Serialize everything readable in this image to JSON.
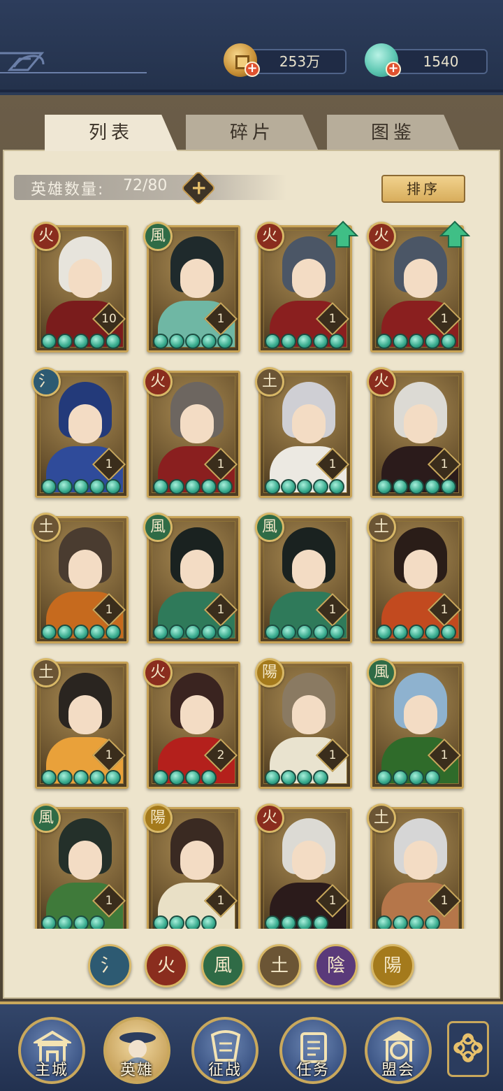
{
  "currency": {
    "copper": {
      "value": "253万",
      "icon": "copper-coin-icon"
    },
    "jade": {
      "value": "1540",
      "icon": "jade-icon"
    }
  },
  "tabs": [
    {
      "label": "列表",
      "active": true
    },
    {
      "label": "碎片",
      "active": false
    },
    {
      "label": "图鉴",
      "active": false
    }
  ],
  "hero_count": {
    "label": "英雄数量:",
    "value": "72/80"
  },
  "sort_button": "排序",
  "element_colors": {
    "水": "#2d5a72",
    "火": "#8a2d1e",
    "风": "#2f6b46",
    "土": "#6b5535",
    "阴": "#5a3a7a",
    "阳": "#a47a1c"
  },
  "element_glyphs": {
    "水": "氵",
    "火": "火",
    "风": "風",
    "土": "土",
    "阴": "陰",
    "阳": "陽"
  },
  "heroes": [
    {
      "element": "火",
      "level": "10",
      "stars": 5,
      "upgrade": false,
      "hair": "#e7e4dc",
      "outfit": "#7a1c1c"
    },
    {
      "element": "风",
      "level": "1",
      "stars": 5,
      "upgrade": false,
      "hair": "#1f2a2c",
      "outfit": "#6fb7a4"
    },
    {
      "element": "火",
      "level": "1",
      "stars": 5,
      "upgrade": true,
      "hair": "#4b5666",
      "outfit": "#8a1f1f"
    },
    {
      "element": "火",
      "level": "1",
      "stars": 5,
      "upgrade": true,
      "hair": "#4b5666",
      "outfit": "#8a1f1f"
    },
    {
      "element": "水",
      "level": "1",
      "stars": 5,
      "upgrade": false,
      "hair": "#233a7a",
      "outfit": "#2f4b9a"
    },
    {
      "element": "火",
      "level": "1",
      "stars": 5,
      "upgrade": false,
      "hair": "#6d6660",
      "outfit": "#8a1f1f"
    },
    {
      "element": "土",
      "level": "1",
      "stars": 5,
      "upgrade": false,
      "hair": "#cfcfd4",
      "outfit": "#ece9e2"
    },
    {
      "element": "火",
      "level": "1",
      "stars": 5,
      "upgrade": false,
      "hair": "#dcdad4",
      "outfit": "#2b1b1b"
    },
    {
      "element": "土",
      "level": "1",
      "stars": 5,
      "upgrade": false,
      "hair": "#4a3c30",
      "outfit": "#c66a1e"
    },
    {
      "element": "风",
      "level": "1",
      "stars": 5,
      "upgrade": false,
      "hair": "#1a2220",
      "outfit": "#2f7a5a"
    },
    {
      "element": "风",
      "level": "1",
      "stars": 5,
      "upgrade": false,
      "hair": "#1a2220",
      "outfit": "#2f7a5a"
    },
    {
      "element": "土",
      "level": "1",
      "stars": 5,
      "upgrade": false,
      "hair": "#2a1d18",
      "outfit": "#c24a1f"
    },
    {
      "element": "土",
      "level": "1",
      "stars": 5,
      "upgrade": false,
      "hair": "#2a2520",
      "outfit": "#e9a13a"
    },
    {
      "element": "火",
      "level": "2",
      "stars": 4,
      "upgrade": false,
      "hair": "#3a2420",
      "outfit": "#b4201c"
    },
    {
      "element": "阳",
      "level": "1",
      "stars": 4,
      "upgrade": false,
      "hair": "#8a7a62",
      "outfit": "#e9e3cf"
    },
    {
      "element": "风",
      "level": "1",
      "stars": 4,
      "upgrade": false,
      "hair": "#8eb2cf",
      "outfit": "#2f6b2a"
    },
    {
      "element": "风",
      "level": "1",
      "stars": 4,
      "upgrade": false,
      "hair": "#24302a",
      "outfit": "#3f7a3a"
    },
    {
      "element": "阳",
      "level": "1",
      "stars": 4,
      "upgrade": false,
      "hair": "#3a2a22",
      "outfit": "#e9e0c6"
    },
    {
      "element": "火",
      "level": "1",
      "stars": 4,
      "upgrade": false,
      "hair": "#dcdad4",
      "outfit": "#2b1b1b"
    },
    {
      "element": "土",
      "level": "1",
      "stars": 4,
      "upgrade": false,
      "hair": "#d6d6d6",
      "outfit": "#b5764a"
    }
  ],
  "filters": [
    {
      "element": "水",
      "glyph": "氵"
    },
    {
      "element": "火",
      "glyph": "火"
    },
    {
      "element": "风",
      "glyph": "風"
    },
    {
      "element": "土",
      "glyph": "土"
    },
    {
      "element": "阴",
      "glyph": "陰"
    },
    {
      "element": "阳",
      "glyph": "陽"
    }
  ],
  "nav": [
    {
      "label": "主城",
      "icon": "city-gate-icon",
      "active": false
    },
    {
      "label": "英雄",
      "icon": "hero-portrait-icon",
      "active": true
    },
    {
      "label": "征战",
      "icon": "campaign-icon",
      "active": false
    },
    {
      "label": "任务",
      "icon": "task-scroll-icon",
      "active": false
    },
    {
      "label": "盟会",
      "icon": "alliance-pavilion-icon",
      "active": false
    }
  ],
  "nav_more_icon": "menu-knot-icon"
}
